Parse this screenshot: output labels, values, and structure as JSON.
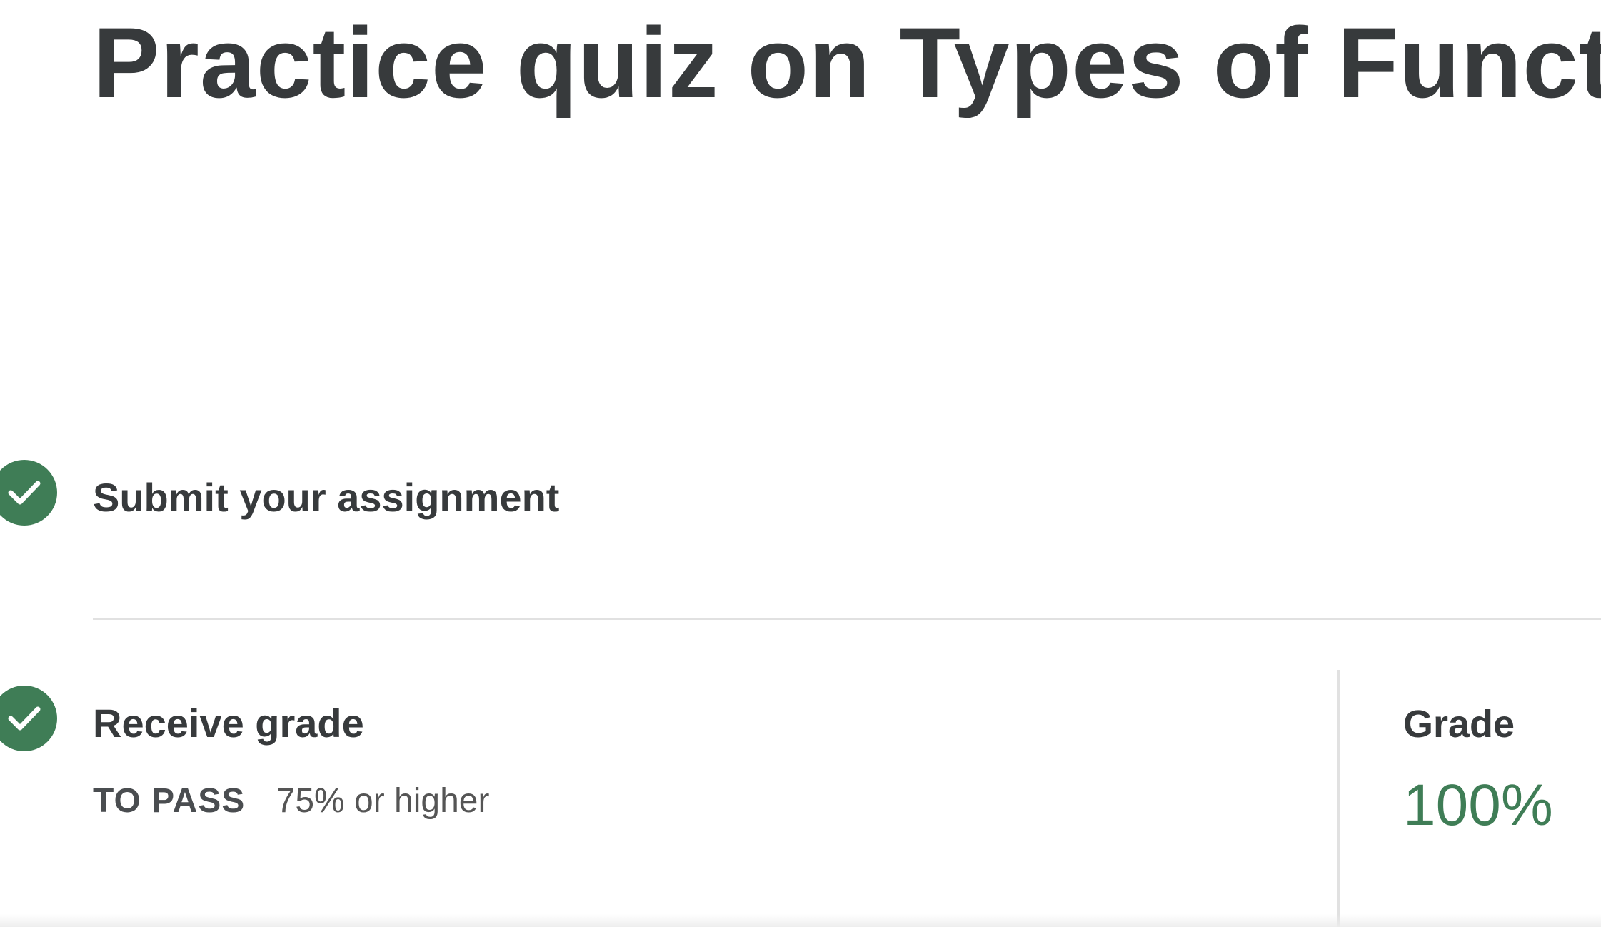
{
  "header": {
    "title": "Practice quiz on Types of Functi"
  },
  "steps": [
    {
      "label": "Submit your assignment",
      "status": "complete",
      "icon": "check-icon"
    },
    {
      "label": "Receive grade",
      "status": "complete",
      "icon": "check-icon"
    }
  ],
  "pass_requirement": {
    "label": "TO PASS",
    "value": "75% or higher"
  },
  "grade": {
    "title": "Grade",
    "value": "100%"
  },
  "colors": {
    "accent_green": "#3f7d56",
    "text_dark": "#373a3c",
    "divider": "#e1e1e1"
  }
}
